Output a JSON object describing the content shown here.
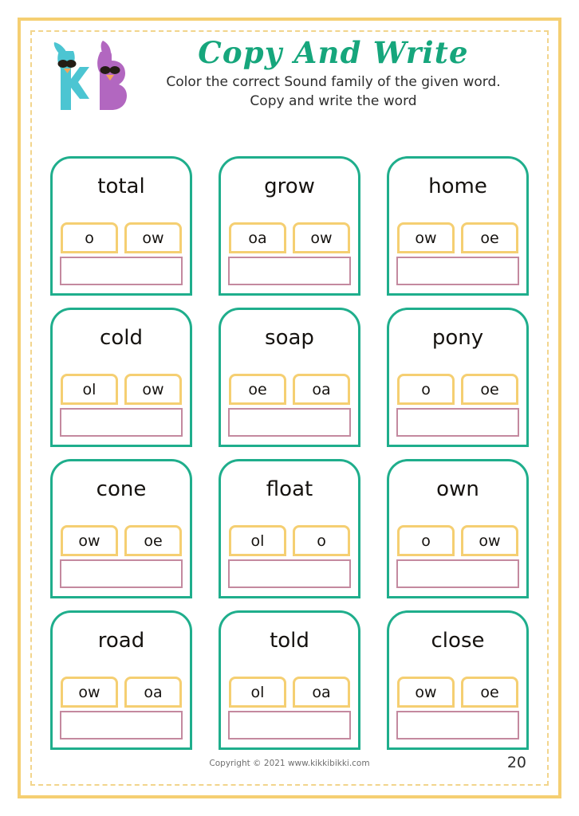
{
  "header": {
    "logo_alt": "kikkibikki-logo",
    "title": "Copy And Write",
    "instruction_line1": "Color the correct Sound family of the given word.",
    "instruction_line2": "Copy and write the word"
  },
  "colors": {
    "frame_solid": "#f5cf72",
    "frame_dashed": "#f2d58c",
    "card_border": "#1fae8c",
    "option_border": "#f5cf72",
    "write_border": "#c4899f",
    "title": "#16a67c",
    "logo_teal": "#4cc5d2",
    "logo_purple": "#b267c0"
  },
  "cards": [
    {
      "word": "total",
      "options": [
        "o",
        "ow"
      ]
    },
    {
      "word": "grow",
      "options": [
        "oa",
        "ow"
      ]
    },
    {
      "word": "home",
      "options": [
        "ow",
        "oe"
      ]
    },
    {
      "word": "cold",
      "options": [
        "ol",
        "ow"
      ]
    },
    {
      "word": "soap",
      "options": [
        "oe",
        "oa"
      ]
    },
    {
      "word": "pony",
      "options": [
        "o",
        "oe"
      ]
    },
    {
      "word": "cone",
      "options": [
        "ow",
        "oe"
      ]
    },
    {
      "word": "float",
      "options": [
        "ol",
        "o"
      ]
    },
    {
      "word": "own",
      "options": [
        "o",
        "ow"
      ]
    },
    {
      "word": "road",
      "options": [
        "ow",
        "oa"
      ]
    },
    {
      "word": "told",
      "options": [
        "ol",
        "oa"
      ]
    },
    {
      "word": "close",
      "options": [
        "ow",
        "oe"
      ]
    }
  ],
  "footer": {
    "copyright": "Copyright © 2021 www.kikkibikki.com",
    "page_number": "20"
  }
}
